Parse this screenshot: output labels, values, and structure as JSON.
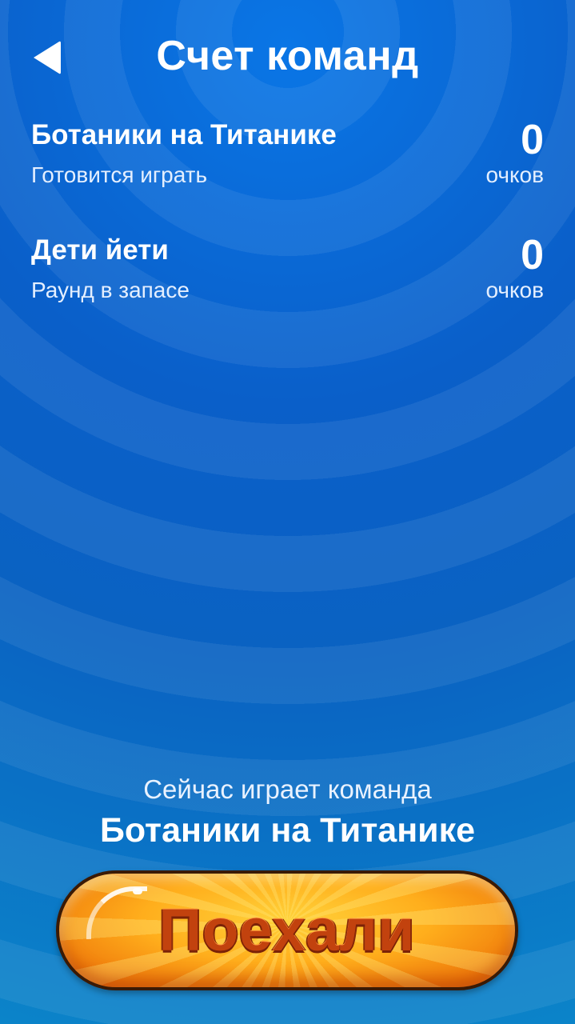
{
  "header": {
    "title": "Счет команд",
    "back_icon": "back-arrow-icon"
  },
  "teams": [
    {
      "name": "Ботаники на Титанике",
      "status": "Готовится играть",
      "score": "0",
      "points_label": "очков"
    },
    {
      "name": "Дети йети",
      "status": "Раунд в запасе",
      "score": "0",
      "points_label": "очков"
    }
  ],
  "now_playing": {
    "caption": "Сейчас играет команда",
    "team": "Ботаники на Титанике"
  },
  "action_button": {
    "label": "Поехали"
  },
  "colors": {
    "background_primary": "#0a62c2",
    "button_orange": "#ffae1c",
    "button_text": "#c2420e"
  }
}
